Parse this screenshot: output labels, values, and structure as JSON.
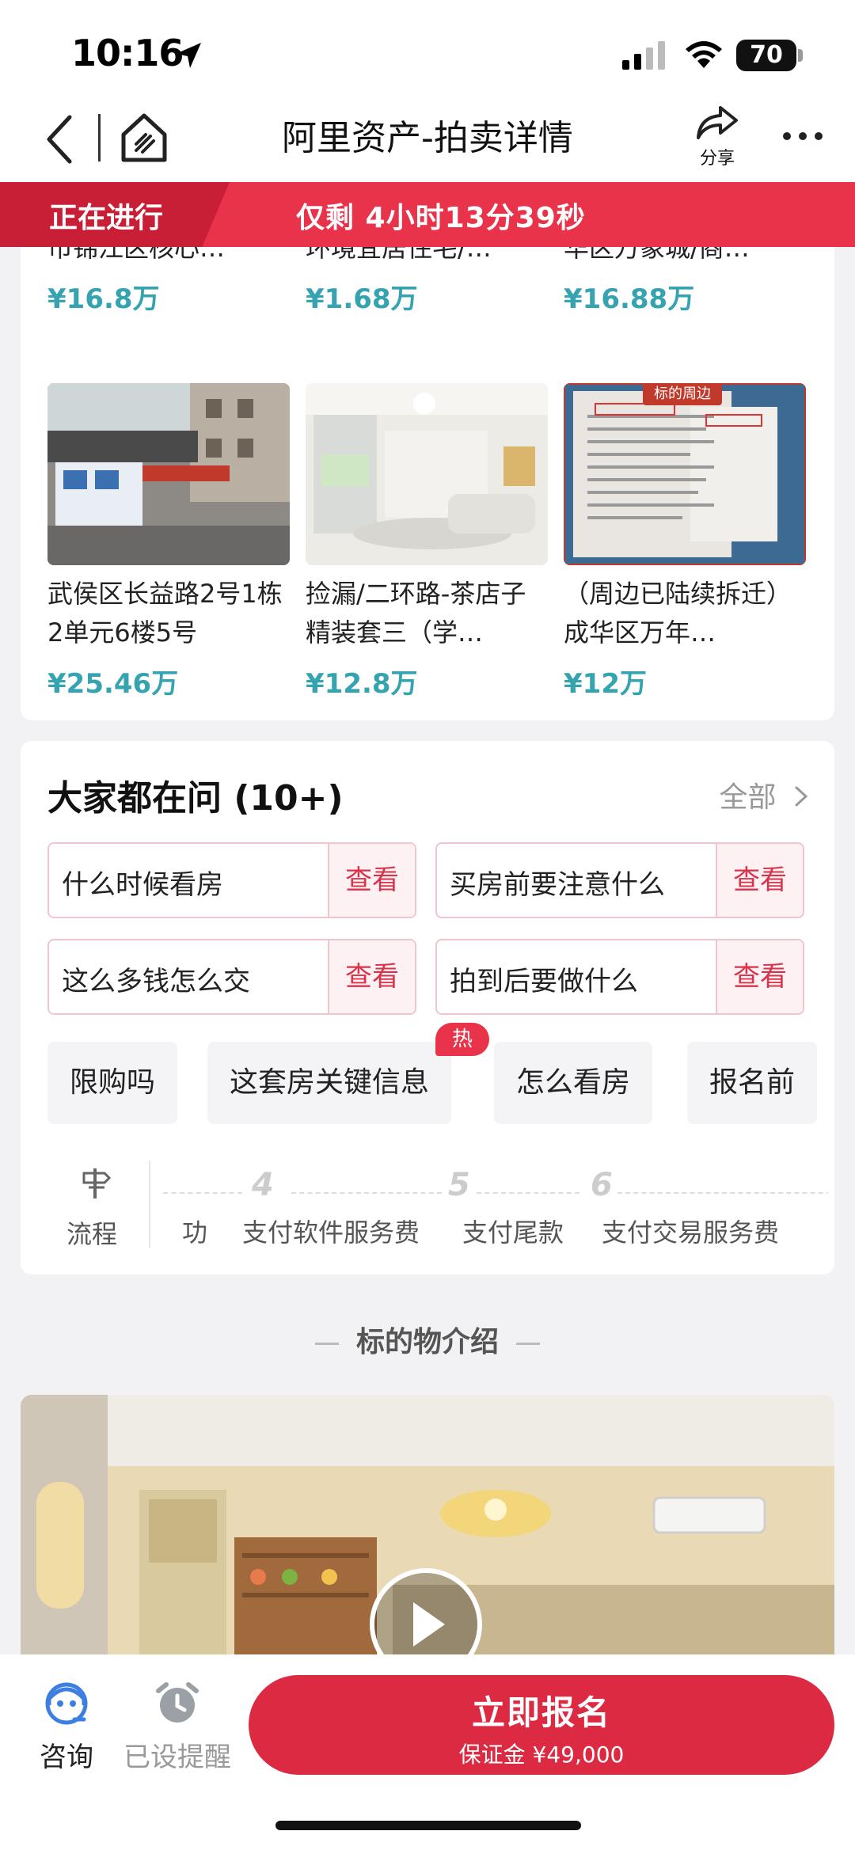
{
  "status_bar": {
    "time": "10:16",
    "battery": "70"
  },
  "nav": {
    "title": "阿里资产-拍卖详情",
    "share_label": "分享"
  },
  "banner": {
    "status": "正在进行",
    "countdown": "仅剩  4小时13分39秒"
  },
  "related": [
    {
      "name": "二环内老破小）成都市锦江区核心…",
      "price": "¥16.8万"
    },
    {
      "name": "特价捡漏】新都绝佳环境宜居住宅/…",
      "price": "¥1.68万"
    },
    {
      "name": "周边拆迁老破小）成华区万象城/商…",
      "price": "¥16.88万"
    },
    {
      "name": "武侯区长益路2号1栋2单元6楼5号",
      "price": "¥25.46万"
    },
    {
      "name": "捡漏/二环路-茶店子精装套三（学…",
      "price": "¥12.8万"
    },
    {
      "name": "（周边已陆续拆迁）成华区万年…",
      "price": "¥12万",
      "image_tag": "标的周边"
    }
  ],
  "questions": {
    "title": "大家都在问 (10+)",
    "all_label": "全部",
    "items": [
      {
        "text": "什么时候看房",
        "action": "查看"
      },
      {
        "text": "买房前要注意什么",
        "action": "查看"
      },
      {
        "text": "这么多钱怎么交",
        "action": "查看"
      },
      {
        "text": "拍到后要做什么",
        "action": "查看"
      }
    ],
    "chips": [
      "限购吗",
      "这套房关键信息",
      "怎么看房",
      "报名前"
    ],
    "hot_tag": "热"
  },
  "flow": {
    "label": "流程",
    "steps": [
      {
        "num": "",
        "text": "功"
      },
      {
        "num": "4",
        "text": "支付软件服务费"
      },
      {
        "num": "5",
        "text": "支付尾款"
      },
      {
        "num": "6",
        "text": "支付交易服务费"
      }
    ]
  },
  "section_title": "标的物介绍",
  "bottom": {
    "consult_label": "咨询",
    "reminder_label": "已设提醒",
    "cta_label": "立即报名",
    "deposit": "保证金  ¥49,000"
  },
  "colors": {
    "accent": "#dc2a43",
    "price": "#35a3b0"
  }
}
